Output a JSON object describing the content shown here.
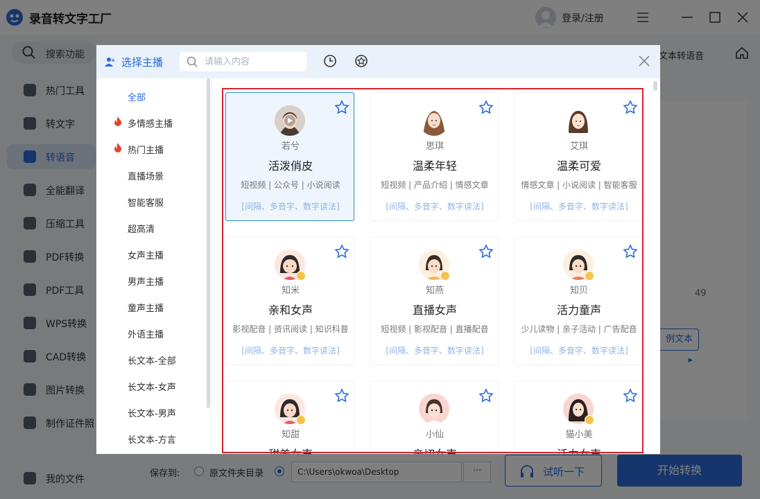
{
  "app": {
    "title": "录音转文字工厂",
    "login": "登录/注册"
  },
  "sidebar": {
    "search_label": "搜索功能",
    "items": [
      {
        "label": "热门工具"
      },
      {
        "label": "转文字"
      },
      {
        "label": "转语音"
      },
      {
        "label": "全能翻译"
      },
      {
        "label": "压缩工具"
      },
      {
        "label": "PDF转换"
      },
      {
        "label": "PDF工具"
      },
      {
        "label": "WPS转换"
      },
      {
        "label": "CAD转换"
      },
      {
        "label": "图片转换"
      },
      {
        "label": "制作证件照"
      },
      {
        "label": "我的文件"
      }
    ]
  },
  "main": {
    "tab_label": "文本转语音",
    "count": "49",
    "example_btn": "例文本",
    "save_to_label": "保存到:",
    "option_source": "原文件夹目录",
    "path_value": "C:\\Users\\okwoa\\Desktop",
    "more_btn": "···",
    "listen_btn": "试听一下",
    "start_btn": "开始转换"
  },
  "modal": {
    "title": "选择主播",
    "search_placeholder": "请输入内容",
    "categories": [
      {
        "label": "全部"
      },
      {
        "label": "多情感主播"
      },
      {
        "label": "热门主播"
      },
      {
        "label": "直播场景"
      },
      {
        "label": "智能客服"
      },
      {
        "label": "超高清"
      },
      {
        "label": "女声主播"
      },
      {
        "label": "男声主播"
      },
      {
        "label": "童声主播"
      },
      {
        "label": "外语主播"
      },
      {
        "label": "长文本-全部"
      },
      {
        "label": "长文本-女声"
      },
      {
        "label": "长文本-男声"
      },
      {
        "label": "长文本-方言"
      }
    ],
    "voices": [
      {
        "name": "若兮",
        "style": "活泼俏皮",
        "tags": "短视频 | 公众号 | 小说阅读",
        "features": "[间隔、多音字、数字读法]"
      },
      {
        "name": "思琪",
        "style": "温柔年轻",
        "tags": "短视频 | 产品介绍 | 情感文章",
        "features": "[间隔、多音字、数字读法]"
      },
      {
        "name": "艾琪",
        "style": "温柔可爱",
        "tags": "情感文章 | 小说阅读 | 智能客服",
        "features": "[间隔、多音字、数字读法]"
      },
      {
        "name": "知米",
        "style": "亲和女声",
        "tags": "影视配音 | 资讯阅读 | 知识科普",
        "features": "[间隔、多音字、数字读法]"
      },
      {
        "name": "知燕",
        "style": "直播女声",
        "tags": "短视频 | 影视配音 | 直播配音",
        "features": "[间隔、多音字、数字读法]"
      },
      {
        "name": "知贝",
        "style": "活力童声",
        "tags": "少儿读物 | 亲子活动 | 广告配音",
        "features": "[间隔、多音字、数字读法]"
      },
      {
        "name": "知甜",
        "style": "甜美女声",
        "tags": "",
        "features": ""
      },
      {
        "name": "小仙",
        "style": "亲切女声",
        "tags": "",
        "features": ""
      },
      {
        "name": "猫小美",
        "style": "活力女声",
        "tags": "",
        "features": ""
      }
    ]
  },
  "colors": {
    "accent": "#2a6ad8",
    "selection_frame": "#d2222d",
    "feature_text": "#8fb4e6"
  }
}
